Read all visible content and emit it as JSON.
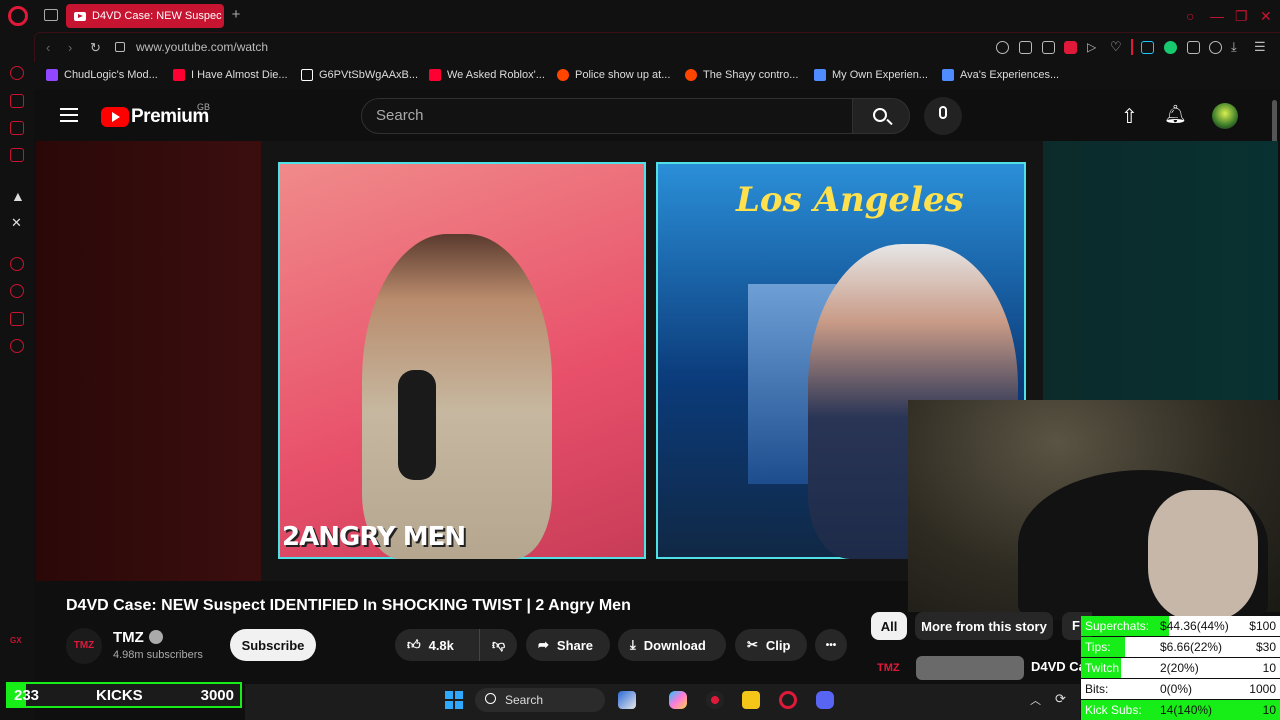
{
  "browser": {
    "tab_title": "D4VD Case: NEW Suspec",
    "url": "www.youtube.com/watch",
    "new_tab_symbol": "+"
  },
  "bookmarks": [
    {
      "label": "ChudLogic's Mod...",
      "color": "#9146ff"
    },
    {
      "label": "I Have Almost Die...",
      "color": "#ff0033"
    },
    {
      "label": "G6PVtSbWgAAxB...",
      "color": "#ffffff"
    },
    {
      "label": "We Asked Roblox'...",
      "color": "#ff0033"
    },
    {
      "label": "Police show up at...",
      "color": "#ff4500"
    },
    {
      "label": "The Shayy contro...",
      "color": "#ff4500"
    },
    {
      "label": "My Own Experien...",
      "color": "#4f8cff"
    },
    {
      "label": "Ava's Experiences...",
      "color": "#4f8cff"
    }
  ],
  "youtube": {
    "logo_text": "Premium",
    "region": "GB",
    "search_placeholder": "Search"
  },
  "video": {
    "overlay_brand": "2ANGRY MEN",
    "overlay_location": "Los Angeles",
    "title": "D4VD Case: NEW Suspect IDENTIFIED In SHOCKING TWIST | 2 Angry Men",
    "channel": "TMZ",
    "channel_avatar_text": "TMZ",
    "subscribers": "4.98m subscribers",
    "subscribe_label": "Subscribe",
    "likes": "4.8k",
    "share_label": "Share",
    "download_label": "Download",
    "clip_label": "Clip",
    "more_symbol": "•••"
  },
  "recommendations": {
    "chips": [
      "All",
      "More from this story",
      "F"
    ],
    "first_channel_logo": "TMZ",
    "first_title": "D4VD Ca"
  },
  "stream_stats": [
    {
      "label": "Superchats:",
      "value": "$44.36(44%)",
      "goal": "$100",
      "fill": 0.44
    },
    {
      "label": "Tips:",
      "value": "$6.66(22%)",
      "goal": "$30",
      "fill": 0.22
    },
    {
      "label": "Twitch Subs:",
      "value": "2(20%)",
      "goal": "10",
      "fill": 0.2
    },
    {
      "label": "Bits:",
      "value": "0(0%)",
      "goal": "1000",
      "fill": 0
    },
    {
      "label": "Kick Subs:",
      "value": "14(140%)",
      "goal": "10",
      "fill": 1
    }
  ],
  "kicks": {
    "count": "233",
    "label": "KICKS",
    "goal": "3000",
    "fill": 0.078
  },
  "taskbar": {
    "search_label": "Search"
  },
  "colors": {
    "accent": "#c71430",
    "goal_green": "#17ee17",
    "frame_cyan": "#4fe1e6"
  }
}
